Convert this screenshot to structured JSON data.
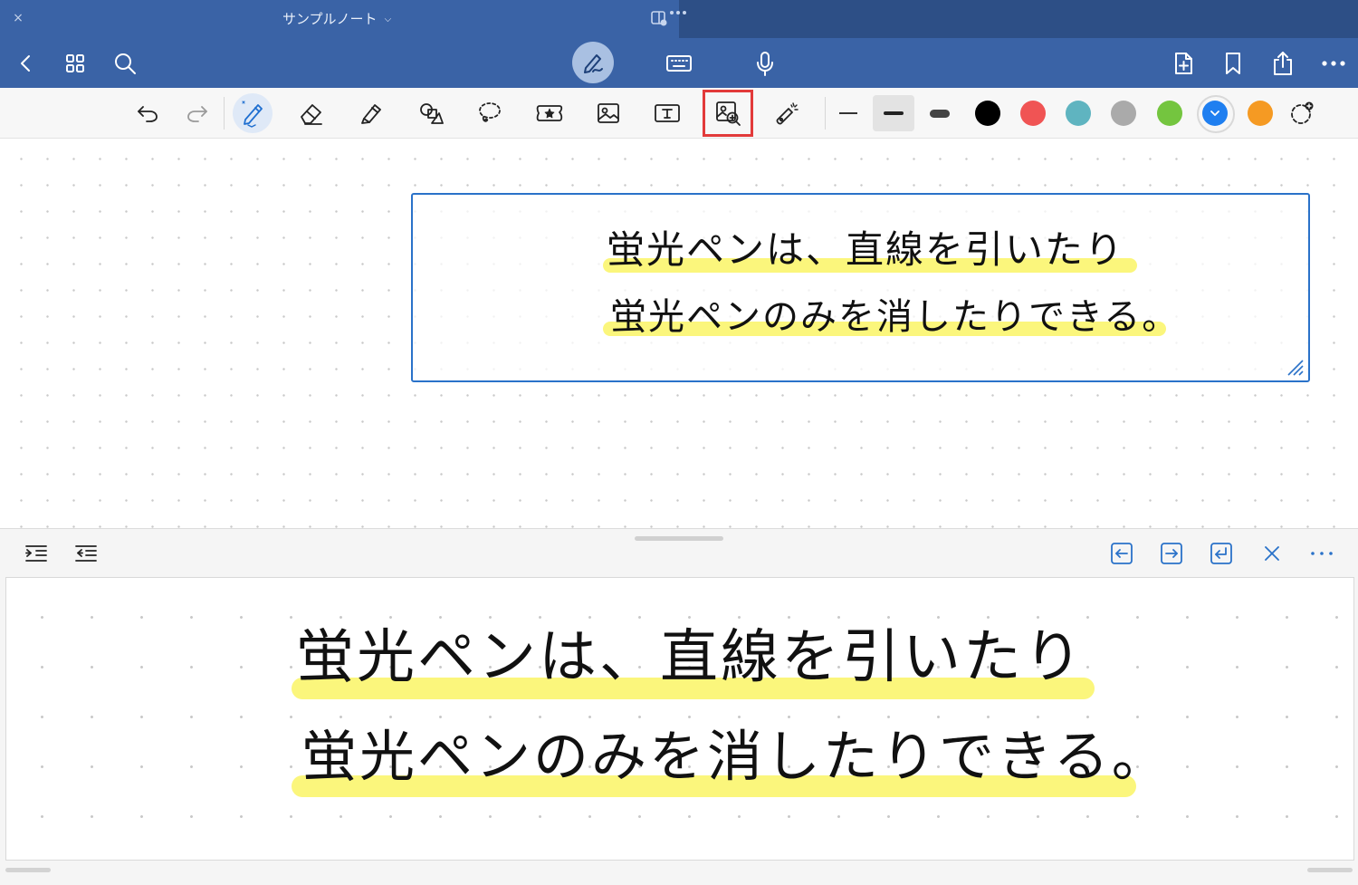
{
  "app": {
    "close_icon": "×",
    "document_title": "サンプルノート",
    "title_chevron": "⌄"
  },
  "nav": {
    "back_icon": "chevron-left-icon",
    "grid_icon": "grid-icon",
    "search_icon": "search-icon",
    "modes": [
      "pen-mode",
      "keyboard-mode",
      "microphone-mode"
    ],
    "right": [
      "add-page-icon",
      "bookmark-icon",
      "share-icon",
      "more-icon"
    ]
  },
  "toolbar": {
    "tools": [
      "undo",
      "redo",
      "pen",
      "eraser",
      "highlighter",
      "shapes",
      "lasso",
      "elements",
      "image",
      "text",
      "zoom-window",
      "laser-pointer"
    ],
    "active_tool": "pen",
    "highlighted_tool": "zoom-window",
    "stroke_widths": [
      "thin",
      "medium",
      "thick"
    ],
    "selected_stroke": "medium",
    "colors": [
      "#000000",
      "#f05454",
      "#5fb4c0",
      "#aaaaaa",
      "#74c53f",
      "#1f7ff0",
      "#f59a23"
    ],
    "selected_color": "#1f7ff0"
  },
  "note": {
    "line1": "蛍光ペンは、直線を引いたり",
    "line2": "蛍光ペンのみを消したりできる。",
    "highlight_color": "#fbf67c"
  },
  "zoom_panel": {
    "left_icons": [
      "indent-icon",
      "outdent-icon"
    ],
    "right_icons": [
      "move-left-icon",
      "move-right-icon",
      "new-line-icon",
      "close-icon",
      "more-icon"
    ],
    "line1": "蛍光ペンは、直線を引いたり",
    "line2": "蛍光ペンのみを消したりできる。"
  }
}
